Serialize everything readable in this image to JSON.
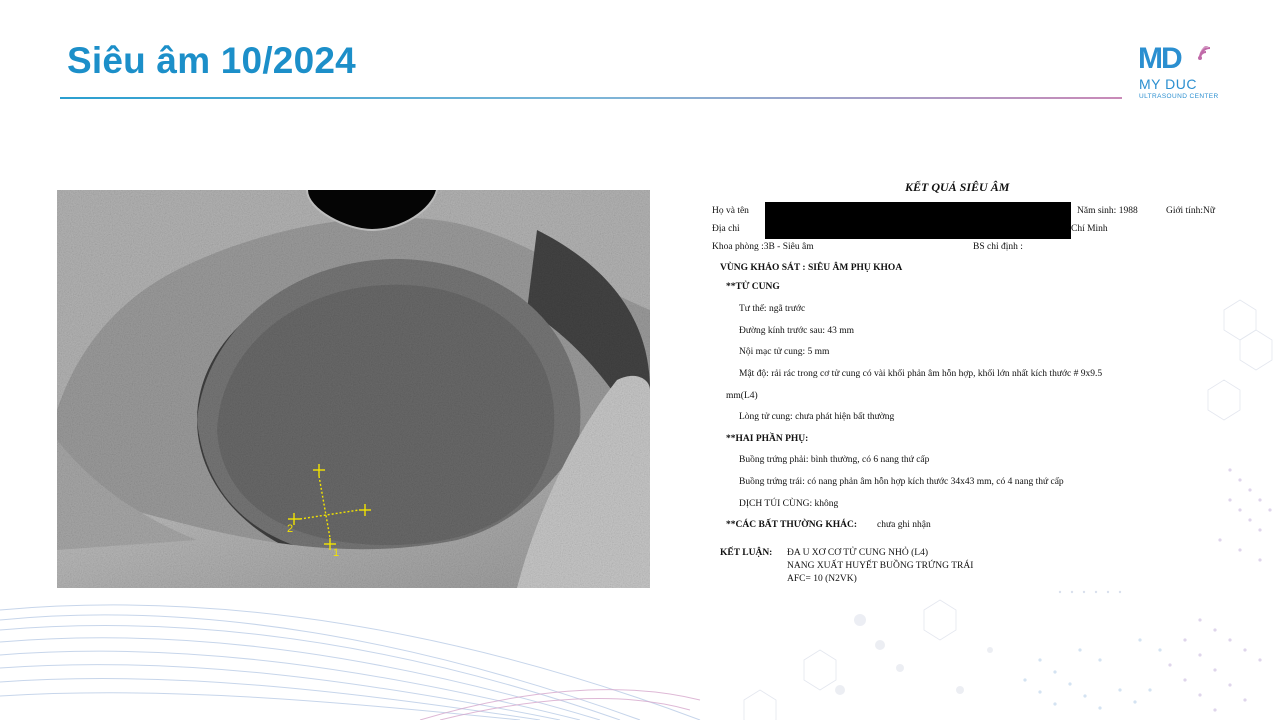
{
  "slide": {
    "title": "Siêu âm 10/2024"
  },
  "logo": {
    "mark": "MD",
    "name": "MY DUC",
    "subtitle": "ULTRASOUND CENTER"
  },
  "ultrasound": {
    "caliper_labels": [
      "2",
      "1"
    ]
  },
  "report": {
    "title": "KẾT QUẢ SIÊU ÂM",
    "name_label": "Họ và tên",
    "birth_year": "Năm sinh: 1988",
    "gender": "Giới tính:Nữ",
    "address_label": "Địa chỉ",
    "address_tail": "Chí Minh",
    "department": "Khoa phòng   :3B - Siêu âm",
    "doctor": "BS chỉ định      :",
    "exam_area": "VÙNG KHẢO SÁT : SIÊU ÂM PHỤ KHOA",
    "uterus_heading": "**TỬ CUNG",
    "uterus_position": "Tư thế:  ngã trước",
    "uterus_diameter": "Đường kính trước sau:  43 mm",
    "endometrium": "Nội mạc tử cung: 5 mm",
    "density": "Mật độ: rải rác trong cơ tử  cung có vài khối phản âm hỗn hợp, khối lớn nhất kích thước #  9x9.5",
    "density_cont": "mm(L4)",
    "uterine_cavity": "Lòng tử cung: chưa phát hiện bất thường",
    "adnexa_heading": "**HAI PHẦN PHỤ:",
    "right_ovary": "Buồng trứng phải: bình thường, có 6 nang thứ cấp",
    "left_ovary": "Buồng trứng trái: có nang phản âm hỗn hợp kích thước 34x43 mm, có  4 nang thứ cấp",
    "cul_de_sac": "DỊCH TÚI CÙNG: không",
    "other_heading": "**CÁC BẤT THƯỜNG KHÁC:",
    "other_value": "chưa ghi nhận",
    "conclusion_label": "KẾT LUẬN:",
    "conclusion_1": "ĐA U XƠ CƠ TỬ CUNG NHỎ (L4)",
    "conclusion_2": "NANG XUẤT HUYẾT BUỒNG TRỨNG  TRÁI",
    "conclusion_3": "AFC=  10  (N2VK)"
  }
}
